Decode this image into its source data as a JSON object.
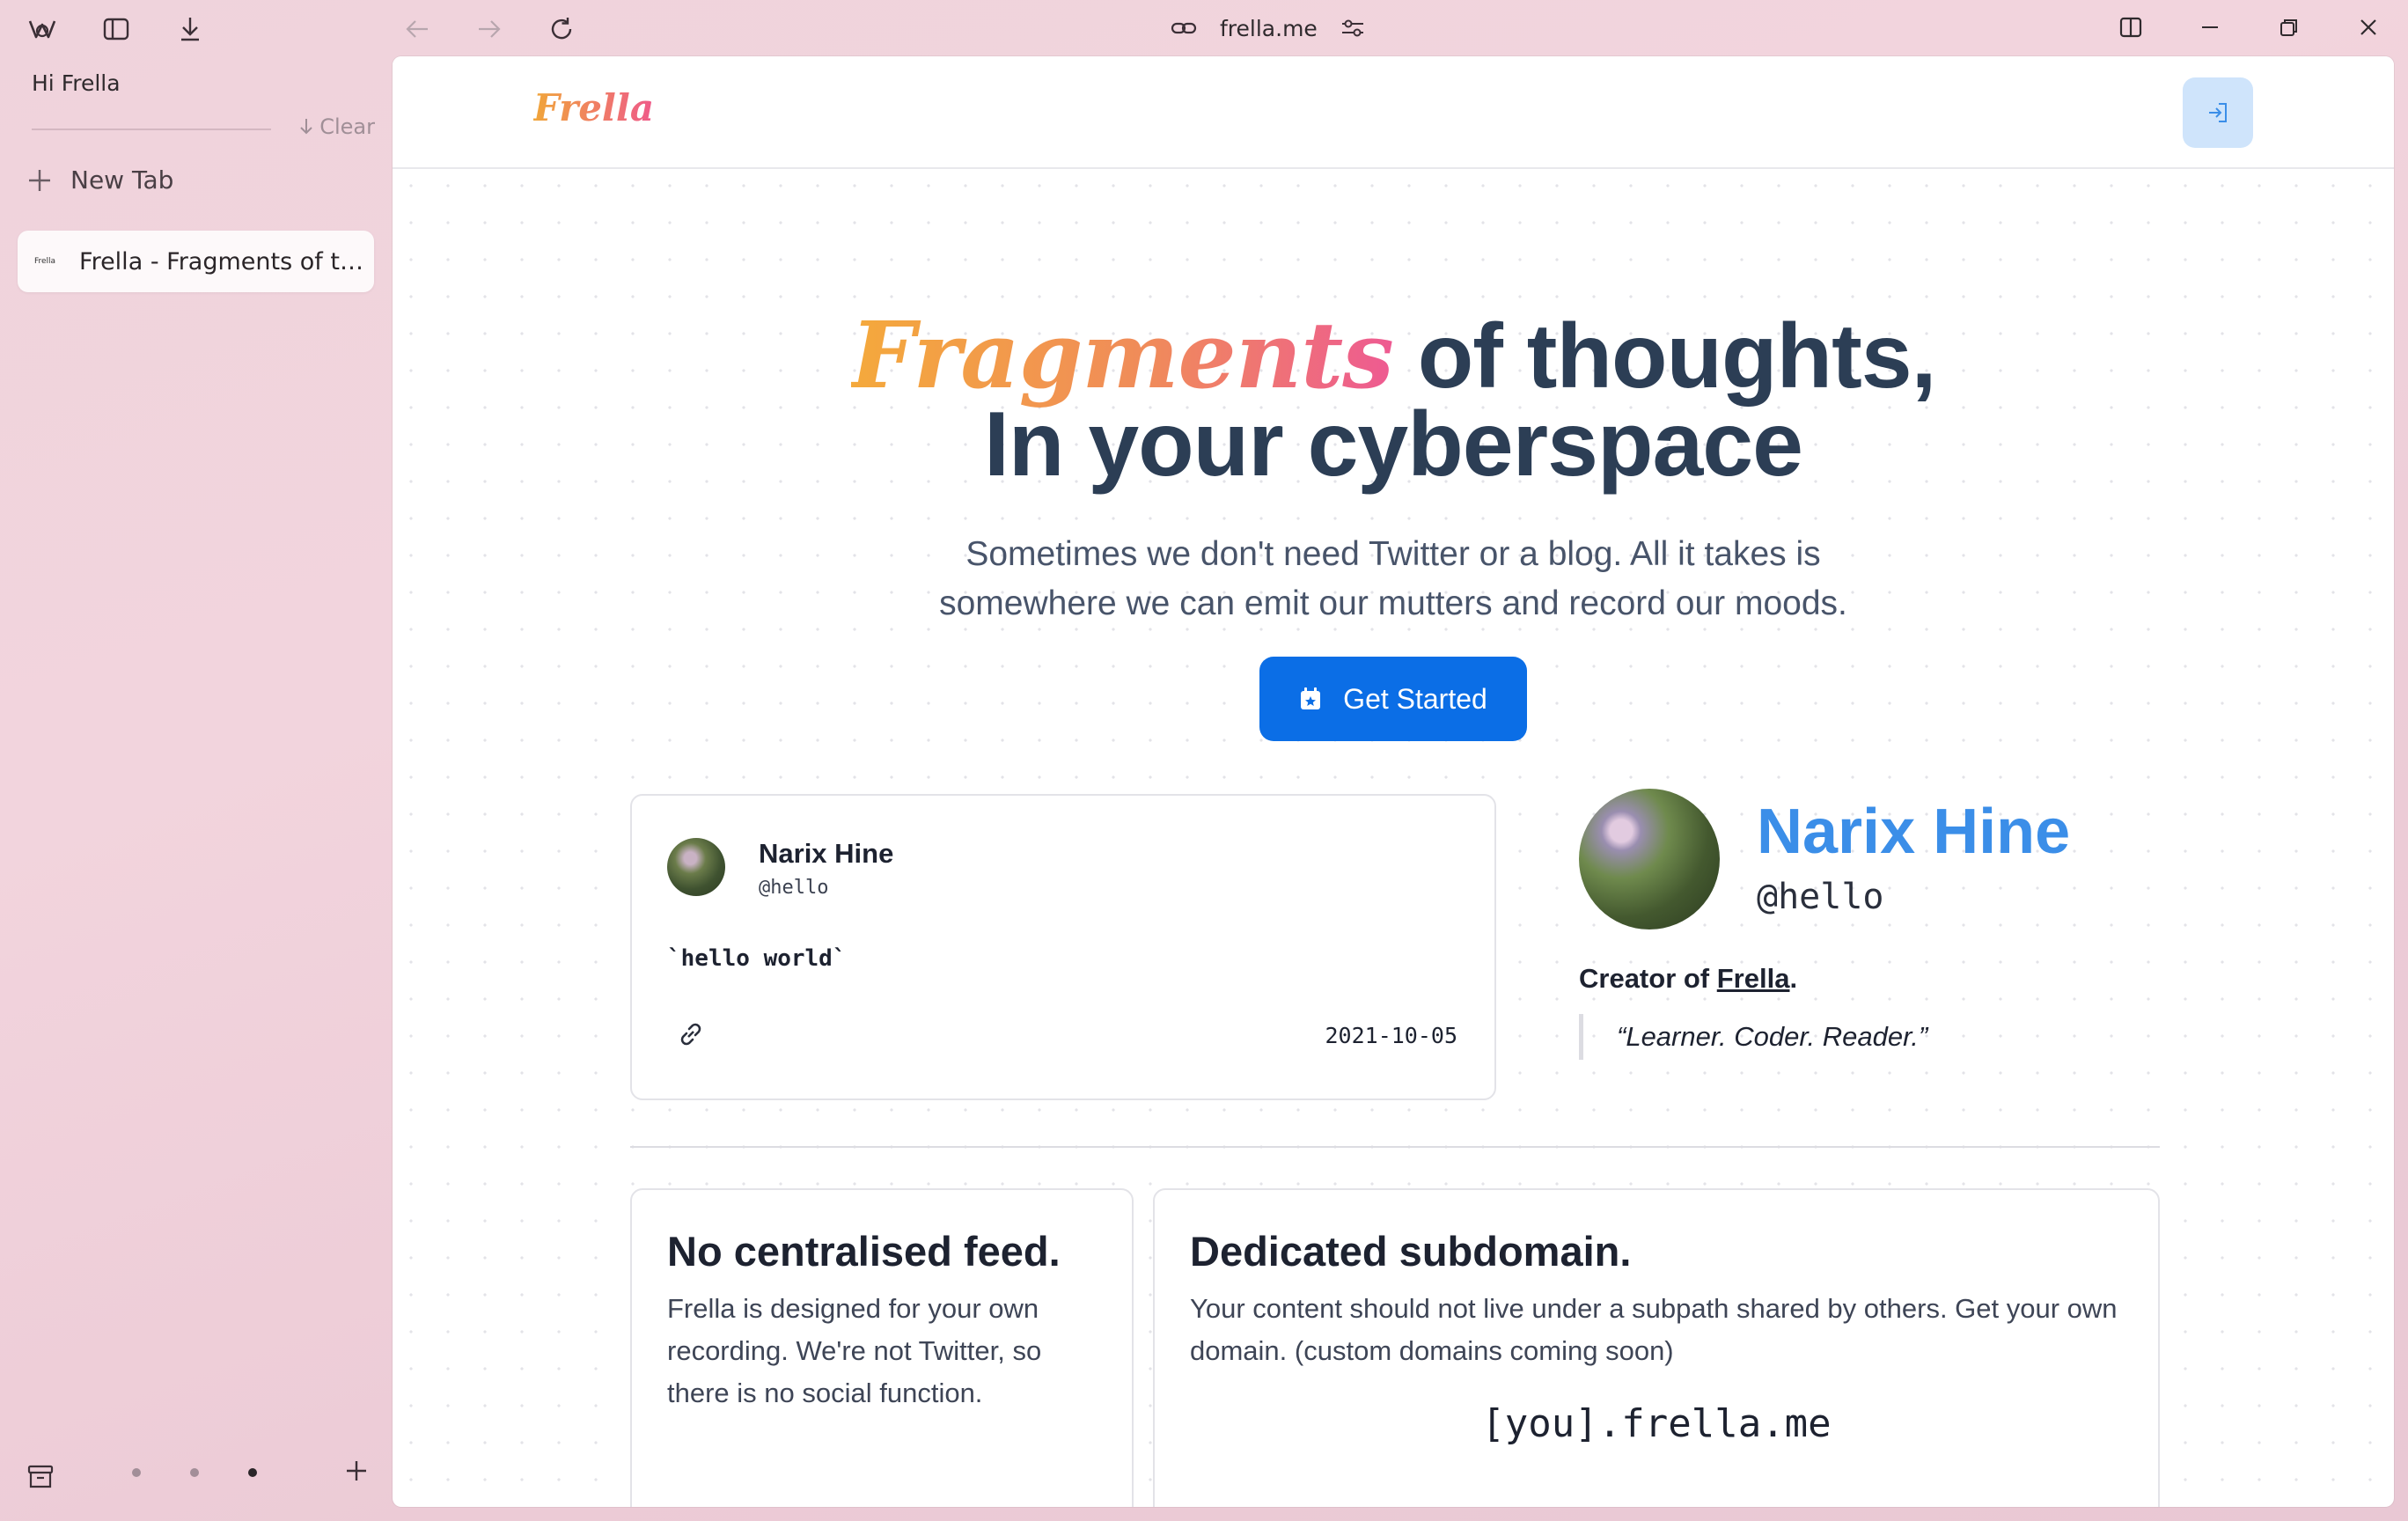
{
  "sidebar": {
    "greeting": "Hi Frella",
    "clear_label": "Clear",
    "new_tab_label": "New Tab",
    "tabs": [
      {
        "favicon_text": "Frella",
        "title": "Frella - Fragments of th..."
      }
    ]
  },
  "browser": {
    "url": "frella.me"
  },
  "site": {
    "logo": "Frella",
    "hero_accent": "Fragments",
    "hero_line1_rest": " of thoughts,",
    "hero_line2": "In your cyberspace",
    "subtitle_line1": "Sometimes we don't need Twitter or a blog. All it takes is",
    "subtitle_line2": "somewhere we can emit our mutters and record our moods.",
    "cta_label": "Get Started"
  },
  "post": {
    "name": "Narix Hine",
    "handle": "@hello",
    "body": "`hello world`",
    "date": "2021-10-05"
  },
  "profile": {
    "name": "Narix Hine",
    "handle": "@hello",
    "creator_prefix": "Creator of ",
    "creator_link": "Frella",
    "creator_suffix": ".",
    "quote": "“Learner. Coder. Reader.”"
  },
  "features": [
    {
      "title": "No centralised feed.",
      "body": "Frella is designed for your own recording. We're not Twitter, so there is no social function."
    },
    {
      "title": "Dedicated subdomain.",
      "body": "Your content should not live under a subpath shared by others. Get your own domain. (custom domains coming soon)",
      "example": "[you].frella.me"
    }
  ],
  "colors": {
    "accent_blue": "#0b6ee6",
    "profile_blue": "#3b8ee8",
    "heading": "#2c3e55",
    "gradient_start": "#f4a93c",
    "gradient_end": "#ee5a92"
  }
}
